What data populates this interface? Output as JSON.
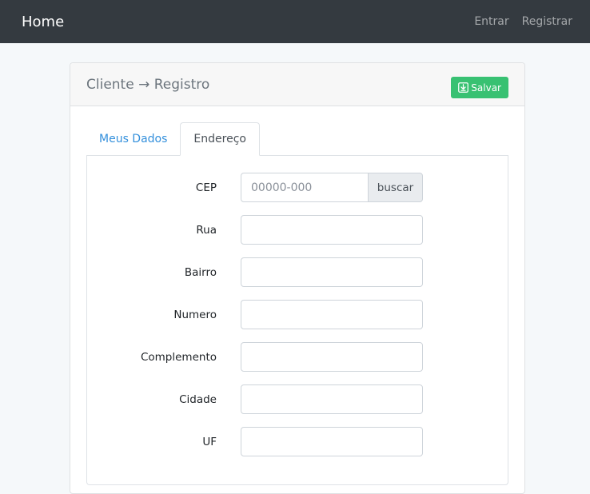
{
  "navbar": {
    "brand": "Home",
    "links": [
      "Entrar",
      "Registrar"
    ]
  },
  "card": {
    "title": "Cliente → Registro",
    "save_label": "Salvar",
    "save_icon": "download-box-icon",
    "save_color": "#38c172"
  },
  "tabs": [
    {
      "label": "Meus Dados",
      "active": false
    },
    {
      "label": "Endereço",
      "active": true
    }
  ],
  "form": {
    "cep": {
      "label": "CEP",
      "placeholder": "00000-000",
      "value": "",
      "button": "buscar"
    },
    "rua": {
      "label": "Rua",
      "value": ""
    },
    "bairro": {
      "label": "Bairro",
      "value": ""
    },
    "numero": {
      "label": "Numero",
      "value": ""
    },
    "complemento": {
      "label": "Complemento",
      "value": ""
    },
    "cidade": {
      "label": "Cidade",
      "value": ""
    },
    "uf": {
      "label": "UF",
      "value": ""
    }
  }
}
